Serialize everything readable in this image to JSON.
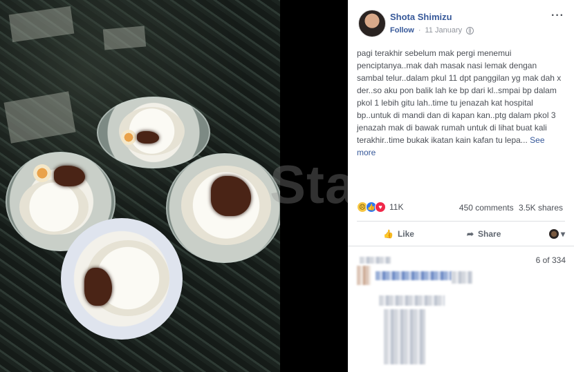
{
  "post": {
    "author": "Shota Shimizu",
    "follow_label": "Follow",
    "separator": "·",
    "date": "11 January",
    "more_icon": "···",
    "text": "pagi terakhir sebelum mak pergi menemui penciptanya..mak dah masak nasi lemak dengan sambal telur..dalam pkul 11 dpt panggilan yg mak dah x der..so aku pon balik lah ke bp dari kl..smpai bp dalam pkol 1 lebih gitu lah..time tu jenazah kat hospital bp..untuk di mandi dan di kapan kan..ptg dalam pkol 3 jenazah mak di bawak rumah untuk di lihat buat kali terakhir..time bukak ikatan kain kafan tu lepa...",
    "see_more": "See more"
  },
  "reactions": {
    "count": "11K",
    "comments": "450 comments",
    "shares": "3.5K shares",
    "icons": [
      "sad-reaction",
      "like-reaction",
      "love-reaction"
    ]
  },
  "actions": {
    "like": "Like",
    "share": "Share",
    "dropdown_icon": "▾"
  },
  "comments": {
    "counter": "6 of 334"
  },
  "photo": {
    "watermark": "Star"
  },
  "colors": {
    "link": "#365899",
    "text": "#4b4f56",
    "muted": "#90949c",
    "divider": "#dddfe2"
  }
}
